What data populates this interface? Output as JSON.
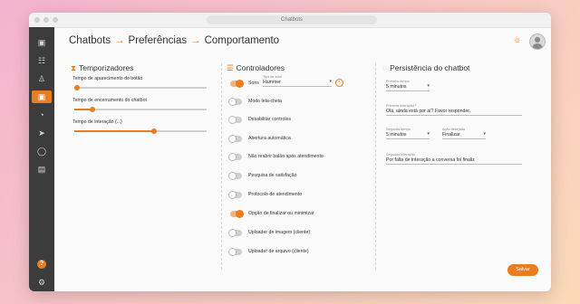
{
  "window": {
    "title": "Chatbots"
  },
  "breadcrumb": {
    "items": [
      "Chatbots",
      "Preferências",
      "Comportamento"
    ]
  },
  "timers": {
    "title": "Temporizadores",
    "items": [
      {
        "label": "Tempo de aparecimento do botão",
        "value": 0.02
      },
      {
        "label": "Tempo de encerramento do chatbot",
        "value": 0.14
      },
      {
        "label": "Tempo de interação (...)",
        "value": 0.6
      }
    ]
  },
  "controllers": {
    "title": "Controladores",
    "sound": {
      "label": "Sons",
      "on": true,
      "select_label": "Tipo de som",
      "select_value": "Hammer"
    },
    "toggles": [
      {
        "label": "Modo tela-cheia",
        "on": false
      },
      {
        "label": "Desabilitar controles",
        "on": false
      },
      {
        "label": "Abertura automática",
        "on": false
      },
      {
        "label": "Não reabrir balão após atendimento",
        "on": false
      },
      {
        "label": "Pesquisa de satisfação",
        "on": false
      },
      {
        "label": "Protocolo de atendimento",
        "on": false
      },
      {
        "label": "Opção de finalizar ou minimizar",
        "on": true
      },
      {
        "label": "Uploader de imagem (cliente)",
        "on": false
      },
      {
        "label": "Uploader de arquivo (cliente)",
        "on": false
      }
    ]
  },
  "persistence": {
    "title": "Persistência do chatbot",
    "first_time": {
      "label": "Primeiro tempo",
      "value": "5 minutos"
    },
    "first_interaction": {
      "label": "Primeira interação *",
      "value": "Olá, ainda está por aí? Favor responder."
    },
    "second_time": {
      "label": "Segundo tempo",
      "value": "5 minutos"
    },
    "action": {
      "label": "Ação desejada",
      "value": "Finalizar"
    },
    "second_interaction": {
      "label": "Segunda interação",
      "value": "Por falta de interação a conversa foi finaliz"
    }
  },
  "actions": {
    "save_label": "Salvar"
  },
  "colors": {
    "accent": "#e97d1f",
    "sidebar": "#3c3c3c"
  }
}
